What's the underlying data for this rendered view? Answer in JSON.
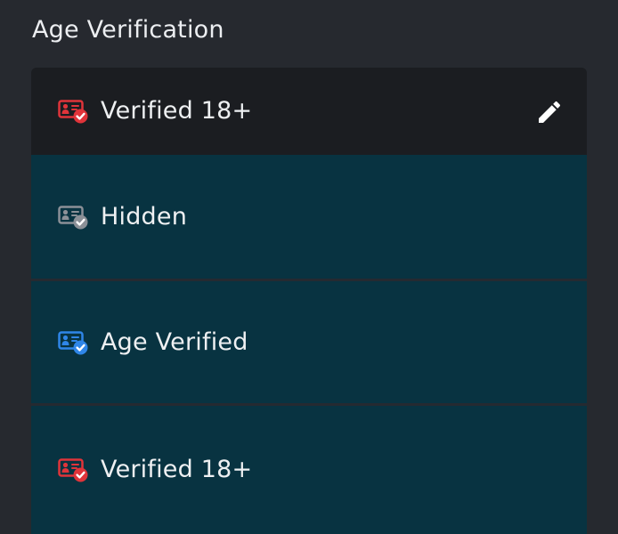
{
  "section": {
    "title": "Age Verification"
  },
  "current": {
    "label": "Verified 18+",
    "icon": "id-card-check-icon",
    "icon_color": "#e0343a",
    "edit_icon": "pencil-icon"
  },
  "options": [
    {
      "label": "Hidden",
      "icon": "id-card-check-icon",
      "icon_color": "#8b9097"
    },
    {
      "label": "Age Verified",
      "icon": "id-card-check-icon",
      "icon_color": "#2f86e8"
    },
    {
      "label": "Verified 18+",
      "icon": "id-card-check-icon",
      "icon_color": "#e0343a"
    }
  ],
  "colors": {
    "background": "#26292f",
    "selected_row": "#1b1d21",
    "option_row": "#083341",
    "text": "#eef0f2"
  }
}
